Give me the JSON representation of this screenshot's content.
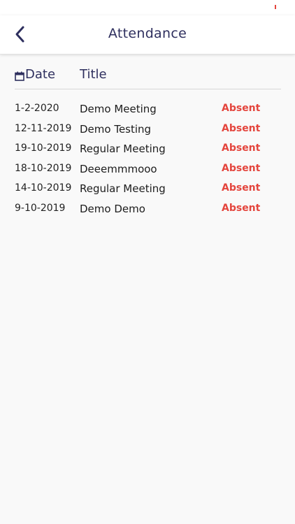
{
  "header": {
    "title": "Attendance",
    "back_icon": "chevron-left-icon"
  },
  "table": {
    "date_header": "Date",
    "title_header": "Title",
    "calendar_icon": "calendar-icon",
    "rows": [
      {
        "date": "1-2-2020",
        "title": "Demo Meeting",
        "status": "Absent"
      },
      {
        "date": "12-11-2019",
        "title": "Demo Testing",
        "status": "Absent"
      },
      {
        "date": "19-10-2019",
        "title": "Regular Meeting",
        "status": "Absent"
      },
      {
        "date": "18-10-2019",
        "title": "Deeemmmooo",
        "status": "Absent"
      },
      {
        "date": "14-10-2019",
        "title": "Regular Meeting",
        "status": "Absent"
      },
      {
        "date": "9-10-2019",
        "title": "Demo Demo",
        "status": "Absent"
      }
    ]
  },
  "colors": {
    "primary_text": "#2e2f5e",
    "absent": "#e4453d",
    "background": "#f9f9f9"
  }
}
